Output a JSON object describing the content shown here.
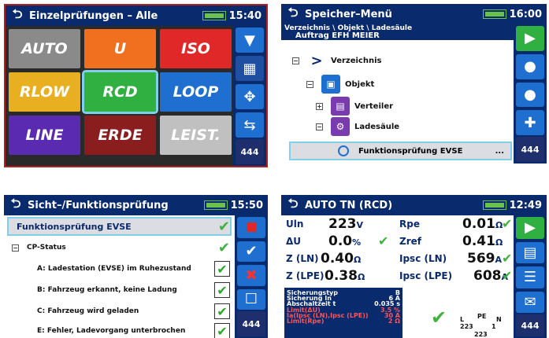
{
  "panel1": {
    "title": "Einzelprüfungen – Alle",
    "time": "15:40",
    "tiles": [
      {
        "label": "AUTO",
        "color": "#8a8a8a"
      },
      {
        "label": "U",
        "color": "#f07020"
      },
      {
        "label": "ISO",
        "color": "#e02828"
      },
      {
        "label": "RLOW",
        "color": "#e8b020"
      },
      {
        "label": "RCD",
        "color": "#30b040"
      },
      {
        "label": "LOOP",
        "color": "#1f6fd1"
      },
      {
        "label": "LINE",
        "color": "#5a2ab0"
      },
      {
        "label": "ERDE",
        "color": "#8a1e1e"
      },
      {
        "label": "LEIST.",
        "color": "#c0c0c0"
      }
    ],
    "dots": "444"
  },
  "panel2": {
    "title": "Speicher–Menü",
    "time": "16:00",
    "crumb_line1": "Verzeichnis \\ Objekt \\ Ladesäule",
    "crumb_line2": "Auftrag EFH MEIER",
    "items": [
      "Verzeichnis",
      "Objekt",
      "Verteiler",
      "Ladesäule"
    ],
    "selected": "Funktionsprüfung EVSE",
    "selected_more": "...",
    "dots": "444"
  },
  "panel3": {
    "title": "Sicht–/Funktionsprüfung",
    "time": "15:50",
    "header": "Funktionsprüfung EVSE",
    "group": "CP-Status",
    "items": [
      "A: Ladestation (EVSE) im Ruhezustand",
      "B: Fahrzeug erkannt, keine Ladung",
      "C: Fahrzeug wird geladen",
      "E: Fehler, Ladevorgang unterbrochen"
    ],
    "dots": "444"
  },
  "panel4": {
    "title": "AUTO TN (RCD)",
    "time": "12:49",
    "left": [
      {
        "label": "Uln",
        "value": "223",
        "unit": "V"
      },
      {
        "label": "ΔU",
        "value": "0.0",
        "unit": "%"
      },
      {
        "label": "Z (LN)",
        "value": "0.40",
        "unit": "Ω"
      },
      {
        "label": "Z (LPE)",
        "value": "0.38",
        "unit": "Ω"
      }
    ],
    "right": [
      {
        "label": "Rpe",
        "value": "0.01",
        "unit": "Ω"
      },
      {
        "label": "Zref",
        "value": "0.41",
        "unit": "Ω"
      },
      {
        "label": "Ipsc (LN)",
        "value": "569",
        "unit": "A"
      },
      {
        "label": "Ipsc (LPE)",
        "value": "608",
        "unit": "A"
      }
    ],
    "info": [
      {
        "k": "Sicherungstyp",
        "v": "B"
      },
      {
        "k": "Sicherung In",
        "v": "6 A"
      },
      {
        "k": "Abschaltzeit t",
        "v": "0.035 s"
      },
      {
        "k": "Limit(ΔU)",
        "v": "3.5 %"
      },
      {
        "k": "Ia(Ipsc (LN),Ipsc (LPE))",
        "v": "30 A"
      },
      {
        "k": "Limit(Rpe)",
        "v": "2 Ω"
      }
    ],
    "diag_l": "L",
    "diag_pe": "PE",
    "diag_n": "N",
    "diag_v1": "223",
    "diag_v2": "1",
    "diag_v3": "223",
    "dots": "444"
  }
}
